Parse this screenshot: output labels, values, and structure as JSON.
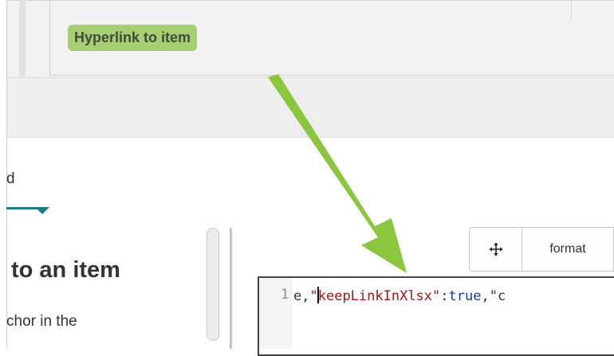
{
  "header": {
    "badge_label": "Hyperlink to item"
  },
  "left_panel": {
    "tab_fragment": "d",
    "heading": "to an item",
    "body_fragment": "chor in the"
  },
  "toolbar": {
    "move_icon": "move-arrows-icon",
    "format_label": "format"
  },
  "editor": {
    "line_number": "1",
    "code_prefix": "e,",
    "code_key": "\"keepLinkInXlsx\"",
    "code_colon": ":",
    "code_value": "true",
    "code_suffix": ",\"c"
  },
  "colors": {
    "badge_bg": "#a6cf74",
    "arrow": "#8cc63f",
    "tab_accent": "#1b7b86"
  }
}
